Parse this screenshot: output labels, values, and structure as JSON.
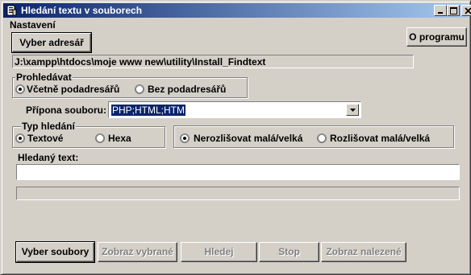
{
  "window": {
    "title": "Hledání textu v souborech",
    "controls": {
      "minimize": "minimize-icon",
      "maximize": "maximize-icon",
      "close": "close-icon"
    }
  },
  "settings": {
    "group_label": "Nastavení",
    "choose_dir_button": "Vyber adresář",
    "about_button": "O programu",
    "path": "J:\\xampp\\htdocs\\moje www new\\utility\\Install_Findtext"
  },
  "browse": {
    "group_label": "Prohledávat",
    "options": [
      "Včetně podadresářů",
      "Bez podadresářů"
    ],
    "selected": 0
  },
  "extension": {
    "label": "Přípona souboru:",
    "value": "PHP;HTML;HTM"
  },
  "search_type": {
    "group_label": "Typ hledání",
    "options": [
      "Textové",
      "Hexa"
    ],
    "selected": 0
  },
  "case": {
    "options": [
      "Nerozlišovat malá/velká",
      "Rozlišovat malá/velká"
    ],
    "selected": 0
  },
  "search_text": {
    "label": "Hledaný text:",
    "value": ""
  },
  "progress": {
    "value": 0
  },
  "buttons": {
    "choose_files": "Vyber soubory",
    "show_selected": "Zobraz vybrané",
    "search": "Hledej",
    "stop": "Stop",
    "show_found": "Zobraz nalezené"
  }
}
